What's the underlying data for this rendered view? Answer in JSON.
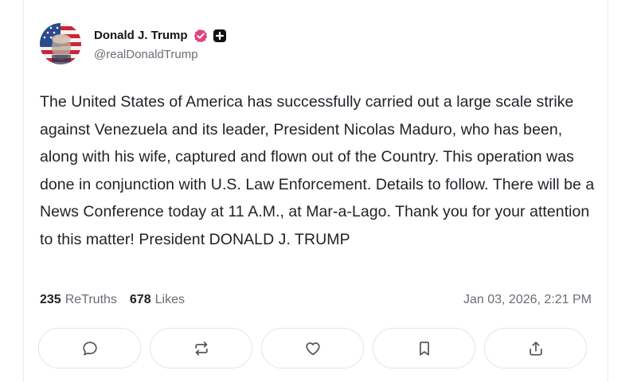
{
  "post": {
    "author": {
      "display_name": "Donald J. Trump",
      "handle": "@realDonaldTrump",
      "avatar_icon": "avatar-flag-portrait",
      "badges": [
        "verified-icon",
        "plus-icon"
      ]
    },
    "text": "The United States of America has successfully carried out a large scale strike against Venezuela and its leader, President Nicolas Maduro, who has been, along with his wife, captured and flown out of the Country. This operation was done in conjunction with U.S. Law Enforcement. Details to follow. There will be a News Conference today at 11 A.M., at Mar-a-Lago. Thank you for your attention to this matter! President DONALD J. TRUMP",
    "stats": {
      "retruths_count": "235",
      "retruths_label": "ReTruths",
      "likes_count": "678",
      "likes_label": "Likes"
    },
    "timestamp": "Jan 03, 2026, 2:21 PM"
  },
  "actions": [
    {
      "name": "reply",
      "icon": "comment-icon"
    },
    {
      "name": "retruth",
      "icon": "repost-icon"
    },
    {
      "name": "like",
      "icon": "heart-icon"
    },
    {
      "name": "bookmark",
      "icon": "bookmark-icon"
    },
    {
      "name": "share",
      "icon": "share-icon"
    }
  ],
  "colors": {
    "verified_badge": "#e2437f",
    "text_primary": "#22222a",
    "text_secondary": "#6b6d76",
    "button_border": "#e3e4e8"
  }
}
